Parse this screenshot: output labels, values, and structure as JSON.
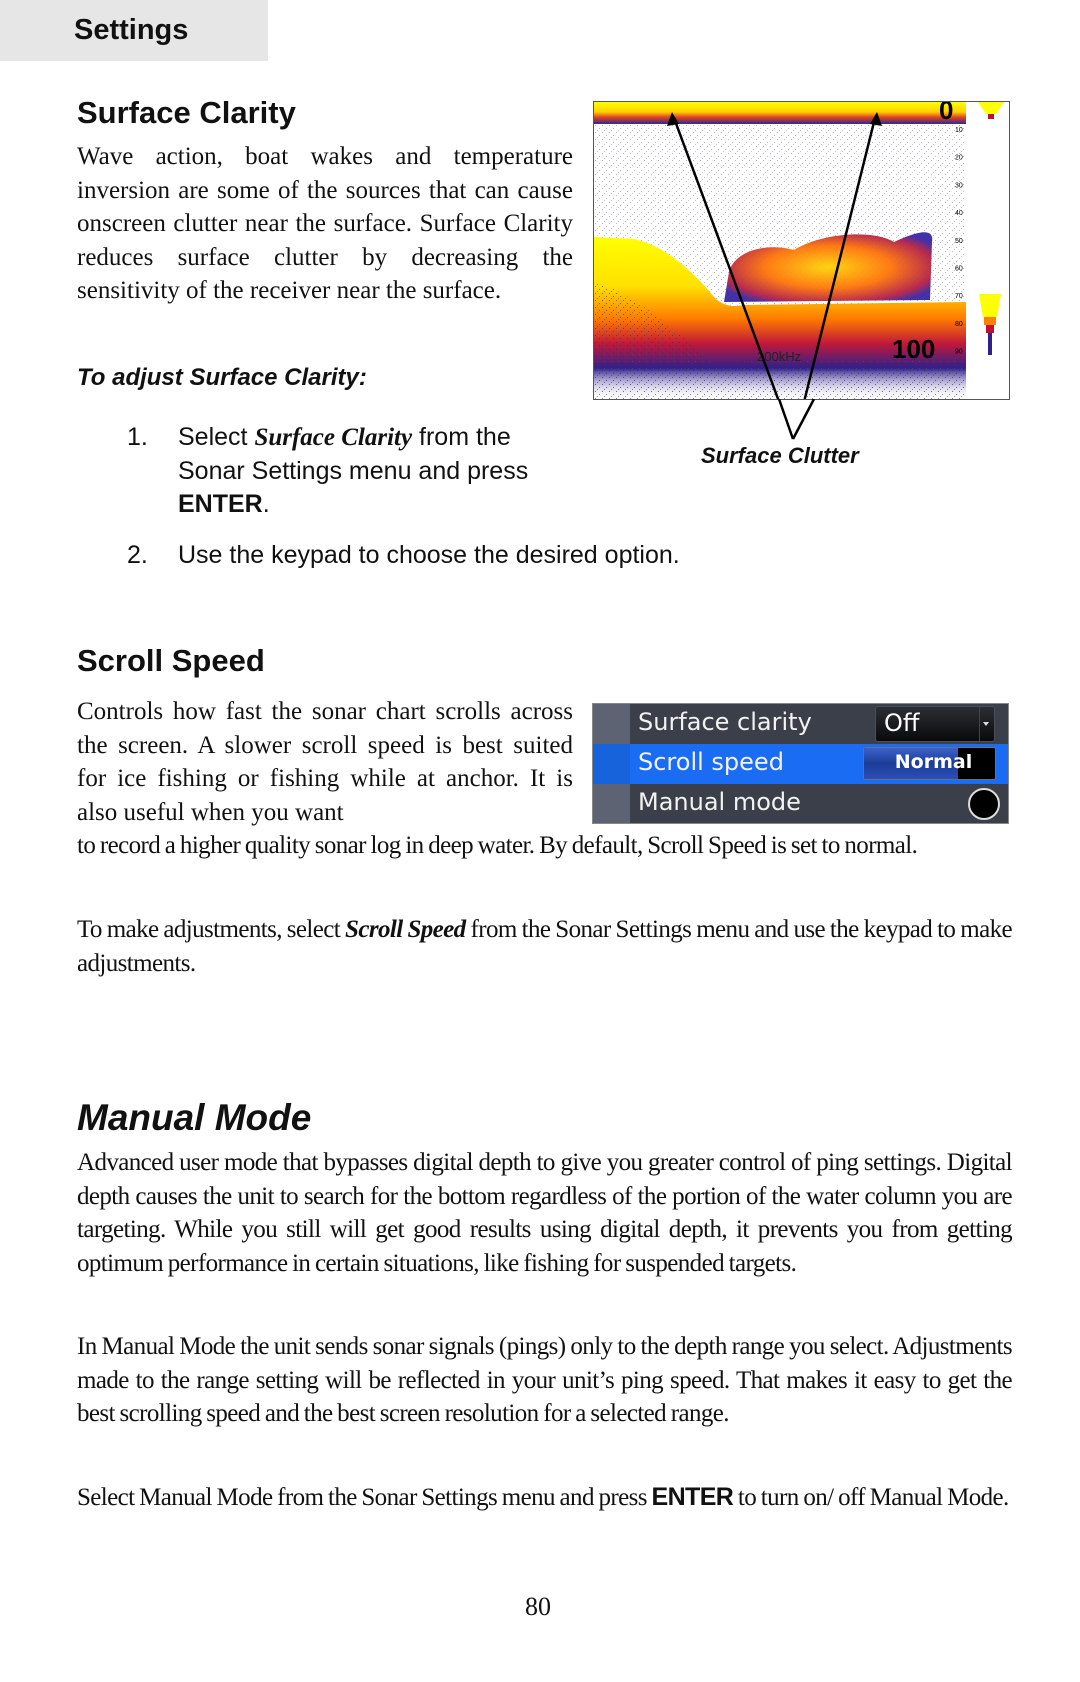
{
  "header": {
    "section_tab": "Settings"
  },
  "surface_clarity": {
    "heading": "Surface Clarity",
    "body": "Wave action, boat wakes and temperature inversion are some of the sources that can cause onscreen clutter near the surface. Surface Clarity reduces surface clutter by decreasing the sensitivity of the receiver near the surface.",
    "procedure_heading": "To adjust Surface Clarity:",
    "steps": [
      {
        "num": "1.",
        "pre": "Select ",
        "emph": "Surface Clarity",
        "mid": " from the Sonar Settings menu and press ",
        "key": "ENTER",
        "post": "."
      },
      {
        "num": "2.",
        "text": "Use the keypad to choose the desired option."
      }
    ],
    "figure": {
      "caption": "Surface Clutter",
      "range_top": "0",
      "range_bottom": "100",
      "frequency": "200kHz",
      "depth_ticks": [
        "10",
        "20",
        "30",
        "40",
        "50",
        "60",
        "70",
        "80",
        "90"
      ],
      "colors": {
        "strong": "#ffff00",
        "mid": "#ff8000",
        "weak": "#c01030",
        "faint": "#20208a"
      }
    }
  },
  "scroll_speed": {
    "heading": "Scroll Speed",
    "body_wrap": "Controls how fast the sonar chart scrolls across the screen. A slower scroll speed is best suited for ice fishing or fishing while at anchor. It is also useful when you want",
    "body_cont": "to record a higher quality sonar log in deep water. By default, Scroll Speed is set to normal.",
    "adjust_pre": "To make adjustments, select ",
    "adjust_emph": "Scroll Speed",
    "adjust_post": " from the Sonar Settings menu and use the keypad to make adjustments.",
    "menu": {
      "rows": [
        {
          "label": "Surface clarity",
          "control": "dropdown",
          "value": "Off"
        },
        {
          "label": "Scroll speed",
          "control": "slider",
          "value": "Normal",
          "fill_fraction": 0.72,
          "selected": true
        },
        {
          "label": "Manual mode",
          "control": "toggle",
          "checked": false
        }
      ],
      "colors": {
        "background": "#3a3f4a",
        "selected": "#1a6cf2",
        "gutter": "#5d6373"
      }
    }
  },
  "manual_mode": {
    "heading": "Manual Mode",
    "para1": "Advanced user mode that bypasses digital depth to give you greater control of ping settings. Digital depth causes the unit to search for the bottom regardless of the portion of the water column you are targeting. While you still will get good results using digital depth, it prevents you from getting optimum performance in certain situations, like fishing for suspended targets.",
    "para2": "In Manual Mode the unit sends sonar signals (pings) only to the depth range you select. Adjustments made to the range setting will be reflected in your unit’s ping speed. That makes it easy to get the best scrolling speed and the best screen resolution for a selected range.",
    "para3_pre": "Select Manual Mode from the Sonar Settings menu and press ",
    "para3_key": "ENTER",
    "para3_post": " to turn on/ off Manual Mode."
  },
  "footer": {
    "page_number": "80"
  }
}
